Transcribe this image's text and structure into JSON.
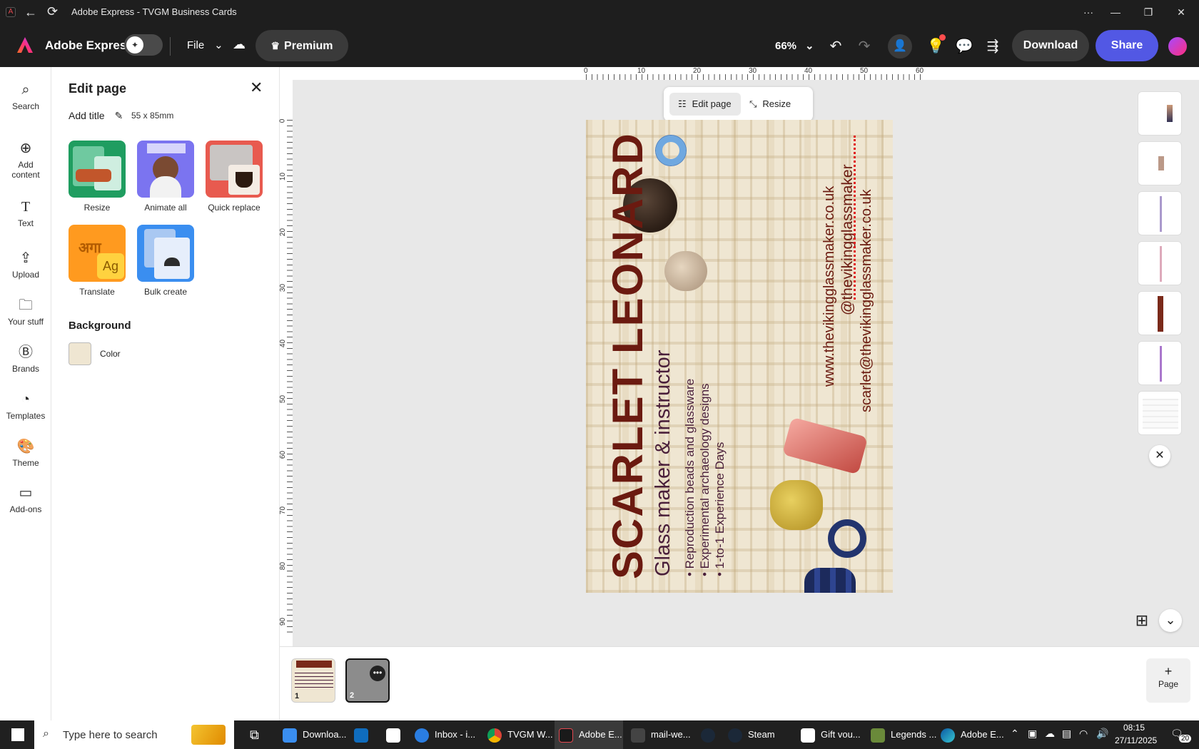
{
  "window": {
    "title": "Adobe Express - TVGM Business Cards"
  },
  "header": {
    "brand": "Adobe Express",
    "file_label": "File",
    "premium_label": "Premium",
    "zoom": "66%",
    "download_label": "Download",
    "share_label": "Share"
  },
  "rail": {
    "items": [
      {
        "label": "Search",
        "icon": "search-icon"
      },
      {
        "label": "Add\ncontent",
        "icon": "plus-circle-icon"
      },
      {
        "label": "Text",
        "icon": "text-icon"
      },
      {
        "label": "Upload",
        "icon": "upload-icon"
      },
      {
        "label": "Your stuff",
        "icon": "folder-icon"
      },
      {
        "label": "Brands",
        "icon": "brands-icon"
      },
      {
        "label": "Templates",
        "icon": "templates-icon"
      },
      {
        "label": "Theme",
        "icon": "palette-icon"
      },
      {
        "label": "Add-ons",
        "icon": "addons-icon"
      }
    ]
  },
  "panel": {
    "title": "Edit page",
    "add_title": "Add title",
    "size": "55 x 85mm",
    "tools": [
      {
        "label": "Resize"
      },
      {
        "label": "Animate all"
      },
      {
        "label": "Quick replace"
      },
      {
        "label": "Translate"
      },
      {
        "label": "Bulk create"
      }
    ],
    "background_heading": "Background",
    "color_label": "Color",
    "background_color": "#efe6d2"
  },
  "canvas": {
    "floating_toolbar": {
      "edit_page": "Edit page",
      "resize": "Resize"
    },
    "ruler_top": [
      "0",
      "10",
      "20",
      "30",
      "40",
      "50",
      "60"
    ],
    "ruler_left": [
      "0",
      "10",
      "20",
      "30",
      "40",
      "50",
      "60",
      "70",
      "80",
      "90"
    ],
    "card": {
      "name": "SCARLET LEONARD",
      "role": "Glass maker & instructor",
      "bullets": [
        "Reproduction beads and glassware",
        "Experimental archaeology designs",
        "1-to-1 Experience Days"
      ],
      "website": "www.thevikingglassmaker.co.uk",
      "handle": "@thevikingglassmaker",
      "email": "scarlet@thevikingglassmaker.co.uk",
      "name_color": "#6b1a10",
      "text_color": "#4a1f3a"
    }
  },
  "filmstrip": {
    "page_numbers": [
      "1",
      "2"
    ],
    "add_page": "Page"
  },
  "taskbar": {
    "search_placeholder": "Type here to search",
    "apps": [
      "Downloa...",
      "Inbox - i...",
      "TVGM W...",
      "Adobe E...",
      "mail-we...",
      "Steam",
      "Gift vou...",
      "Legends ...",
      "Adobe E..."
    ],
    "time": "08:15",
    "date": "27/11/2025",
    "notifications": "20"
  }
}
